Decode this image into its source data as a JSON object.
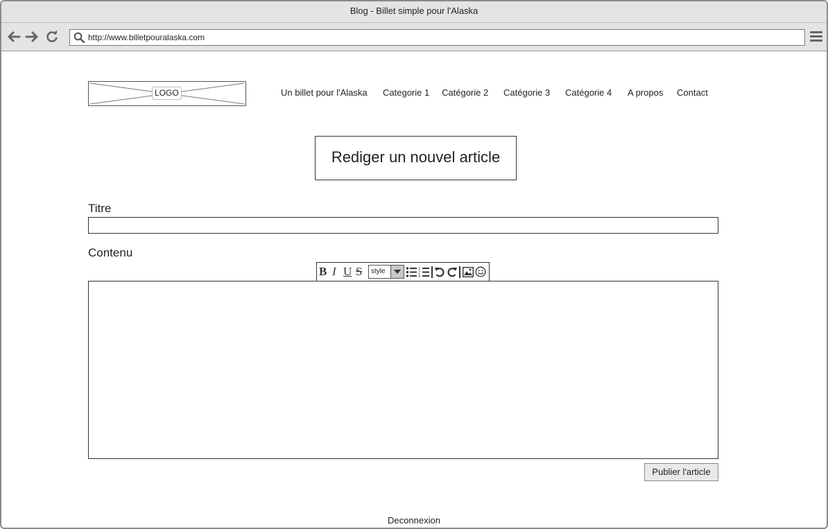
{
  "window": {
    "title": "Blog - Billet simple pour l'Alaska"
  },
  "browser": {
    "url": "http://www.billetpouralaska.com",
    "icons": [
      "back-arrow-icon",
      "forward-arrow-icon",
      "reload-icon",
      "search-icon",
      "hamburger-menu-icon"
    ]
  },
  "header": {
    "logo_label": "LOGO",
    "nav": [
      "Un billet pour l'Alaska",
      "Categorie 1",
      "Catégorie 2",
      "Catégorie 3",
      "Catégorie 4",
      "A propos",
      "Contact"
    ]
  },
  "main": {
    "heading": "Rediger un nouvel article",
    "title_label": "Titre",
    "title_value": "",
    "content_label": "Contenu",
    "content_value": "",
    "editor": {
      "style_select": "style",
      "tools": [
        "bold",
        "italic",
        "underline",
        "strikethrough",
        "style",
        "bulleted-list",
        "numbered-list",
        "undo",
        "redo",
        "image",
        "emoji"
      ]
    },
    "publish_label": "Publier l'article"
  },
  "footer": {
    "logout_label": "Deconnexion"
  }
}
